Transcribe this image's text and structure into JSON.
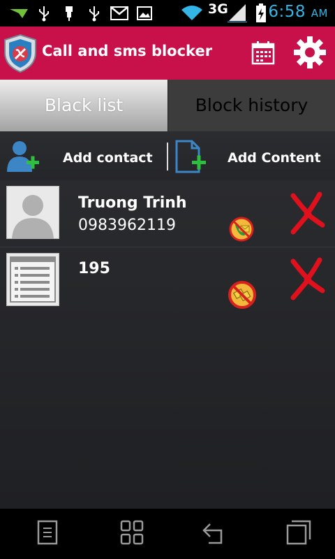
{
  "status_bar": {
    "network": "3G",
    "time": "6:58",
    "ampm": "AM"
  },
  "app_bar": {
    "title": "Call and sms blocker"
  },
  "tabs": [
    {
      "label": "Black list",
      "active": true
    },
    {
      "label": "Block history",
      "active": false
    }
  ],
  "actions": {
    "add_contact_label": "Add contact",
    "add_content_label": "Add Content"
  },
  "blacklist": [
    {
      "name": "Truong Trinh",
      "number": "0983962119",
      "block_type": "sms-block-icon"
    },
    {
      "name": "195",
      "number": "",
      "block_type": "call-sms-block-icon"
    }
  ],
  "colors": {
    "app_bar": "#c8104a",
    "status_time": "#33b5e5",
    "delete": "#e0101c"
  }
}
